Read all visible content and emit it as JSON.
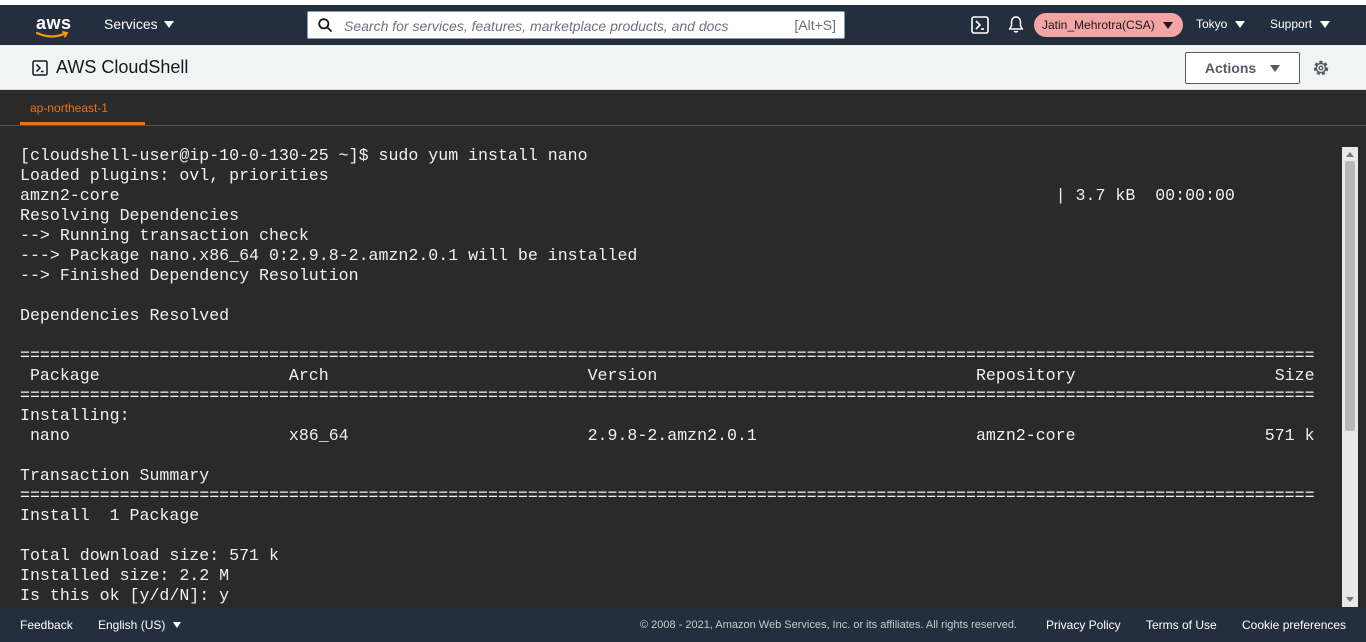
{
  "nav": {
    "logo_text": "aws",
    "services_label": "Services",
    "search_placeholder": "Search for services, features, marketplace products, and docs",
    "search_shortcut": "[Alt+S]",
    "user_label": "Jatin_Mehrotra(CSA)",
    "region_label": "Tokyo",
    "support_label": "Support",
    "colors": {
      "bar": "#232f3e",
      "user_badge": "#f3a5a5",
      "accent": "#ec7211"
    }
  },
  "subheader": {
    "title": "AWS CloudShell",
    "actions_label": "Actions",
    "icons": [
      "cloudshell-icon",
      "gear-icon"
    ]
  },
  "tabs": [
    {
      "label": "ap-northeast-1",
      "active": true
    }
  ],
  "terminal": {
    "lines": [
      "[cloudshell-user@ip-10-0-130-25 ~]$ sudo yum install nano",
      "Loaded plugins: ovl, priorities",
      "amzn2-core                                                                                              | 3.7 kB  00:00:00",
      "Resolving Dependencies",
      "--> Running transaction check",
      "---> Package nano.x86_64 0:2.9.8-2.amzn2.0.1 will be installed",
      "--> Finished Dependency Resolution",
      "",
      "Dependencies Resolved",
      "",
      "==================================================================================================================================",
      " Package                   Arch                          Version                                Repository                    Size",
      "==================================================================================================================================",
      "Installing:",
      " nano                      x86_64                        2.9.8-2.amzn2.0.1                      amzn2-core                   571 k",
      "",
      "Transaction Summary",
      "==================================================================================================================================",
      "Install  1 Package",
      "",
      "Total download size: 571 k",
      "Installed size: 2.2 M",
      "Is this ok [y/d/N]: y"
    ]
  },
  "footer": {
    "feedback": "Feedback",
    "language": "English (US)",
    "copyright": "© 2008 - 2021, Amazon Web Services, Inc. or its affiliates. All rights reserved.",
    "privacy": "Privacy Policy",
    "terms": "Terms of Use",
    "cookies": "Cookie preferences"
  }
}
